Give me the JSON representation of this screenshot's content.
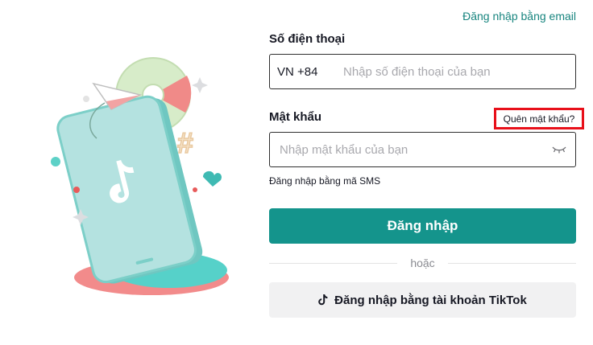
{
  "header": {
    "email_login_link": "Đăng nhập bằng email"
  },
  "phone": {
    "label": "Số điện thoại",
    "country_code": "VN +84",
    "placeholder": "Nhập số điện thoại của bạn",
    "value": ""
  },
  "password": {
    "label": "Mật khẩu",
    "forgot_link": "Quên mật khẩu?",
    "placeholder": "Nhập mật khẩu của bạn",
    "value": ""
  },
  "sms_login_link": "Đăng nhập bằng mã SMS",
  "login_button": "Đăng nhập",
  "divider_text": "hoặc",
  "tiktok_login_button": "Đăng nhập bằng tài khoản TikTok",
  "icons": {
    "eye_toggle": "eye-closed-icon",
    "tiktok": "tiktok-logo-icon"
  },
  "colors": {
    "accent": "#14948c",
    "link": "#18857f",
    "highlight_border": "#e8101a"
  }
}
